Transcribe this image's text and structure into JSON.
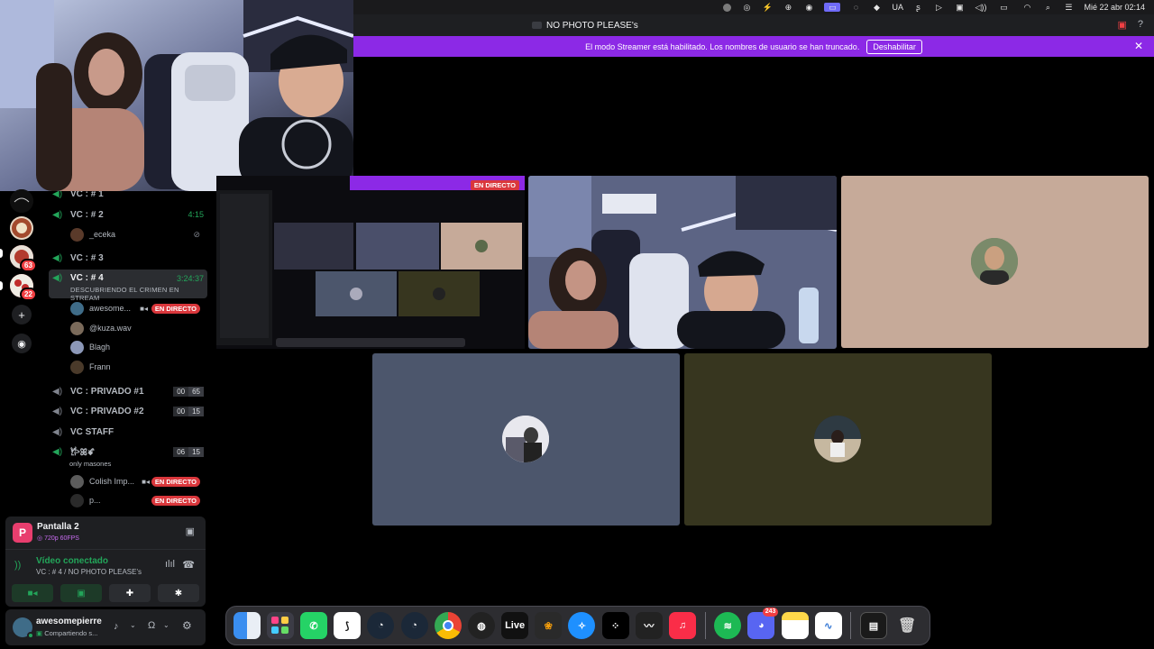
{
  "menubar": {
    "keyboard": "UA",
    "datetime": "Mié 22 abr  02:14"
  },
  "titlebar": {
    "title": "NO PHOTO PLEASE's"
  },
  "banner": {
    "text": "El modo Streamer está habilitado. Los nombres de usuario se han truncado.",
    "button": "Deshabilitar"
  },
  "servers": {
    "badges": [
      "63",
      "22"
    ]
  },
  "channels": {
    "vc1": "VC : # 1",
    "vc2": "VC : # 2",
    "vc2_time": "4:15",
    "vc2_user": "_eceka",
    "vc3": "VC : # 3",
    "vc4": "VC : # 4",
    "vc4_time": "3:24:37",
    "vc4_status": "DESCUBRIENDO EL CRIMEN EN STREAM",
    "vc4_users": [
      "awesome...",
      "@kuza.wav",
      "Blagh",
      "Frann"
    ],
    "live_label": "EN DIRECTO",
    "privado1": "VC : PRIVADO #1",
    "privado1_counts": [
      "00",
      "65"
    ],
    "privado2": "VC : PRIVADO #2",
    "privado2_counts": [
      "00",
      "15"
    ],
    "staff": "VC STAFF",
    "masones_counts": [
      "06",
      "15"
    ],
    "masones_name": "𐂂ꕤꗄ",
    "masones_status": "only masones",
    "masones_users": [
      "Colish Imp...",
      "p..."
    ]
  },
  "share_panel": {
    "title": "Pantalla 2",
    "quality": "720p 60FPS",
    "avatar_letter": "P"
  },
  "voice_panel": {
    "status": "Vídeo conectado",
    "channel": "VC : # 4 / NO PHOTO PLEASE's"
  },
  "user_panel": {
    "name": "awesomepierre",
    "status": "Compartiendo s..."
  },
  "stream_tile": {
    "live_label": "EN DIRECTO"
  },
  "dock": {
    "discord_badge": "243",
    "live_label": "Live",
    "apps": [
      "Finder",
      "Launchpad",
      "WhatsApp",
      "Shortcut",
      "Steam",
      "Steam",
      "Chrome",
      "OBS",
      "Live",
      "FL Studio",
      "Safari",
      "Tidal",
      "Waves",
      "Music",
      "Spotify",
      "Discord",
      "Notes",
      "Freeform",
      "Window",
      "Trash"
    ]
  },
  "colors": {
    "banner": "#8c29e6",
    "live": "#da373c",
    "voice_green": "#23a55a",
    "tile_beige": "#c6aa99",
    "tile_slate": "#4c566c",
    "tile_olive": "#37361f"
  }
}
